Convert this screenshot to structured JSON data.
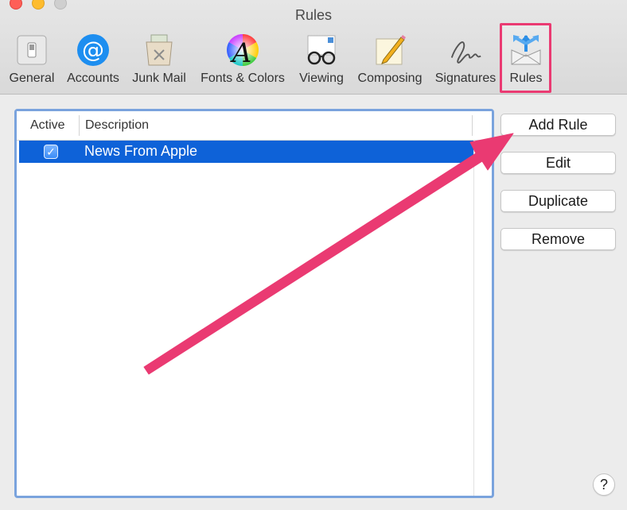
{
  "window": {
    "title": "Rules"
  },
  "toolbar": {
    "items": [
      {
        "label": "General",
        "icon": "general-switch-icon"
      },
      {
        "label": "Accounts",
        "icon": "at-sign-icon"
      },
      {
        "label": "Junk Mail",
        "icon": "junk-mail-bin-icon"
      },
      {
        "label": "Fonts & Colors",
        "icon": "fonts-colors-icon"
      },
      {
        "label": "Viewing",
        "icon": "glasses-icon"
      },
      {
        "label": "Composing",
        "icon": "pencil-note-icon"
      },
      {
        "label": "Signatures",
        "icon": "signature-icon"
      },
      {
        "label": "Rules",
        "icon": "rules-envelope-icon",
        "selected": true
      }
    ]
  },
  "table": {
    "columns": [
      "Active",
      "Description"
    ],
    "rows": [
      {
        "active": true,
        "description": "News From Apple",
        "selected": true
      }
    ]
  },
  "buttons": {
    "add_rule": "Add Rule",
    "edit": "Edit",
    "duplicate": "Duplicate",
    "remove": "Remove"
  },
  "help": {
    "label": "?"
  },
  "colors": {
    "selection": "#0e62d8",
    "highlight_box": "#ea3a72",
    "arrow": "#ea3a72",
    "panel_border": "#7aa3dd"
  }
}
